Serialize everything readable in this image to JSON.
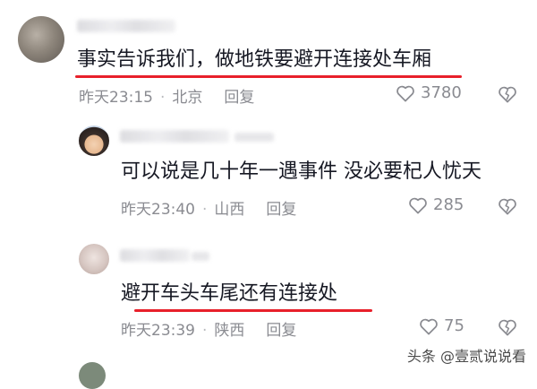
{
  "comments": [
    {
      "text": "事实告诉我们，做地铁要避开连接处车厢",
      "time": "昨天23:15",
      "location": "北京",
      "reply_label": "回复",
      "likes": "3780"
    },
    {
      "text": "可以说是几十年一遇事件 没必要杞人忧天",
      "time": "昨天23:40",
      "location": "山西",
      "reply_label": "回复",
      "likes": "285"
    },
    {
      "text": "避开车头车尾还有连接处",
      "time": "昨天23:39",
      "location": "陕西",
      "reply_label": "回复",
      "likes": "75"
    }
  ],
  "separator": "·",
  "watermark": "头条 @壹贰说说看",
  "icons": {
    "like": "heart-outline-icon",
    "dislike": "broken-heart-icon"
  },
  "colors": {
    "underline": "#e8202b",
    "meta": "#8a8b91",
    "text": "#161823"
  }
}
